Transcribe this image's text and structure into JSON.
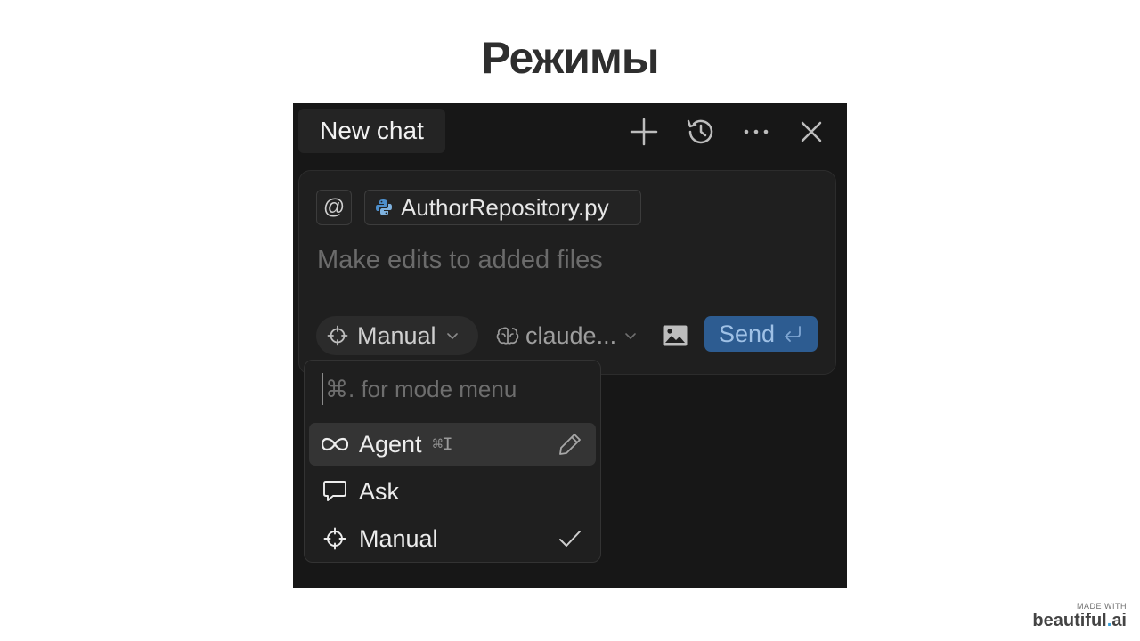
{
  "slide": {
    "title": "Режимы"
  },
  "chat_panel": {
    "tab_label": "New chat",
    "toolbar_icons": [
      "plus-icon",
      "history-icon",
      "more-icon",
      "close-icon"
    ],
    "context": {
      "at_symbol": "@",
      "file_name": "AuthorRepository.py",
      "file_icon": "python-icon"
    },
    "prompt_placeholder": "Make edits to added files",
    "mode_selector": {
      "label": "Manual",
      "icon": "crosshair-icon"
    },
    "model_selector": {
      "label": "claude...",
      "icon": "brain-icon"
    },
    "send_button": {
      "label": "Send",
      "icon": "enter-icon",
      "color": "#2d5c91"
    }
  },
  "mode_menu": {
    "search_placeholder": "⌘. for mode menu",
    "items": [
      {
        "label": "Agent",
        "shortcut": "⌘I",
        "icon": "infinity-icon",
        "right_icon": "pencil-icon"
      },
      {
        "label": "Ask",
        "icon": "chat-bubble-icon"
      },
      {
        "label": "Manual",
        "icon": "crosshair-icon",
        "right_icon": "check-icon"
      }
    ]
  },
  "footer": {
    "made_with": "MADE WITH",
    "brand_main": "beautiful",
    "brand_dot": ".",
    "brand_suffix": "ai"
  }
}
